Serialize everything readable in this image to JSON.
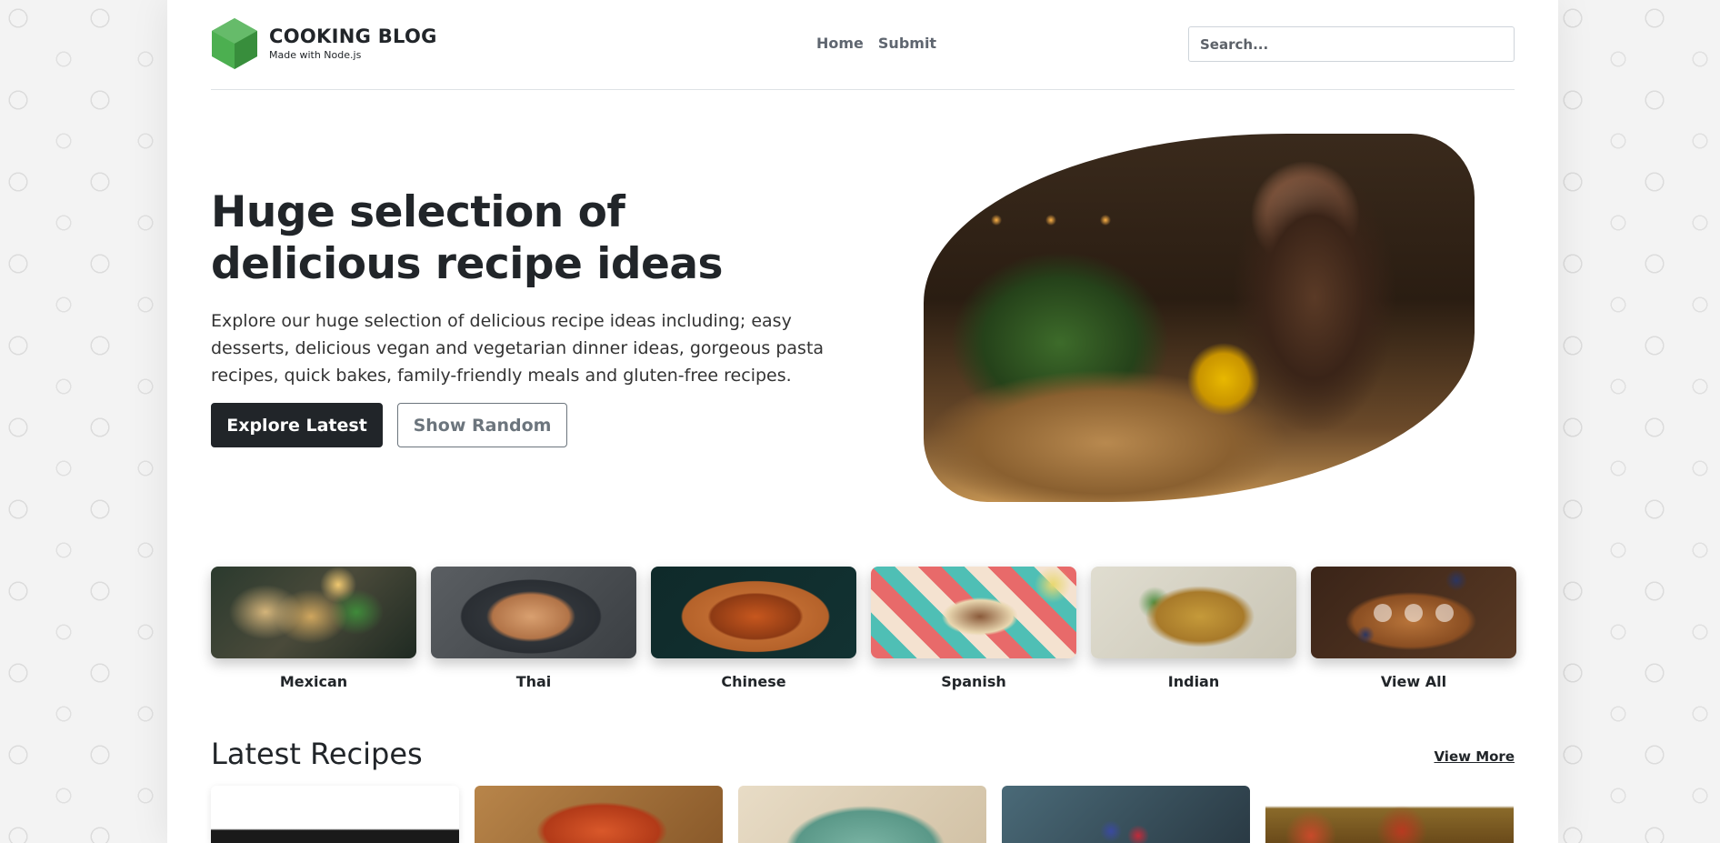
{
  "header": {
    "logo_title": "COOKING BLOG",
    "logo_subtitle": "Made with Node.js",
    "nav": [
      "Home",
      "Submit"
    ],
    "search_placeholder": "Search..."
  },
  "hero": {
    "title": "Huge selection of delicious recipe ideas",
    "text": "Explore our huge selection of delicious recipe ideas including; easy desserts, delicious vegan and vegetarian dinner ideas, gorgeous pasta recipes, quick bakes, family-friendly meals and gluten-free recipes.",
    "primary_button": "Explore Latest",
    "secondary_button": "Show Random"
  },
  "categories": [
    {
      "label": "Mexican"
    },
    {
      "label": "Thai"
    },
    {
      "label": "Chinese"
    },
    {
      "label": "Spanish"
    },
    {
      "label": "Indian"
    },
    {
      "label": "View All"
    }
  ],
  "latest": {
    "title": "Latest Recipes",
    "view_more": "View More"
  },
  "colors": {
    "dark": "#212529",
    "muted": "#6c757d",
    "logo_green": "#4caf50"
  }
}
